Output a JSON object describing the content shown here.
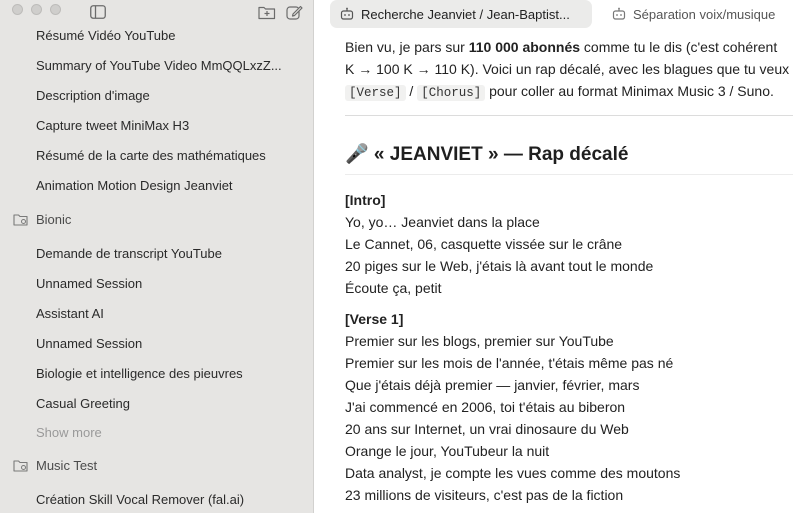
{
  "sidebar": {
    "items_top": [
      "Résumé Vidéo YouTube",
      "Summary of YouTube Video MmQQLxzZ...",
      "Description d'image",
      "Capture tweet MiniMax H3",
      "Résumé de la carte des mathématiques",
      "Animation Motion Design Jeanviet"
    ],
    "project_bionic": "Bionic",
    "items_bionic": [
      "Demande de transcript YouTube",
      "Unnamed Session",
      "Assistant AI",
      "Unnamed Session",
      "Biologie et intelligence des pieuvres",
      "Casual Greeting"
    ],
    "show_more": "Show more",
    "project_music": "Music Test",
    "items_music": [
      "Création Skill Vocal Remover (fal.ai)"
    ]
  },
  "tabs": [
    {
      "label": "Recherche Jeanviet / Jean-Baptist...",
      "icon": "bot-icon",
      "active": true
    },
    {
      "label": "Séparation voix/musique",
      "icon": "bot-icon",
      "active": false
    }
  ],
  "content": {
    "line1_a": "Bien vu, je pars sur ",
    "line1_bold": "110 000 abonnés",
    "line1_b": " comme tu le dis (c'est cohérent",
    "line2": "K → 100 K → 110 K). Voici un rap décalé, avec les blagues que tu veux",
    "code1": "[Verse]",
    "slash": " / ",
    "code2": "[Chorus]",
    "line3_tail": " pour coller au format Minimax Music 3 / Suno.",
    "heading": "🎤 « JEANVIET » — Rap décalé",
    "intro_tag": "[Intro]",
    "intro_lines": [
      "Yo, yo… Jeanviet dans la place",
      "Le Cannet, 06, casquette vissée sur le crâne",
      "20 piges sur le Web, j'étais là avant tout le monde",
      "Écoute ça, petit"
    ],
    "verse_tag": "[Verse 1]",
    "verse_lines": [
      "Premier sur les blogs, premier sur YouTube",
      "Premier sur les mois de l'année, t'étais même pas né",
      "Que j'étais déjà premier — janvier, février, mars",
      "J'ai commencé en 2006, toi t'étais au biberon",
      "20 ans sur Internet, un vrai dinosaure du Web",
      "Orange le jour, YouTubeur la nuit",
      "Data analyst, je compte les vues comme des moutons",
      "23 millions de visiteurs, c'est pas de la fiction"
    ]
  }
}
